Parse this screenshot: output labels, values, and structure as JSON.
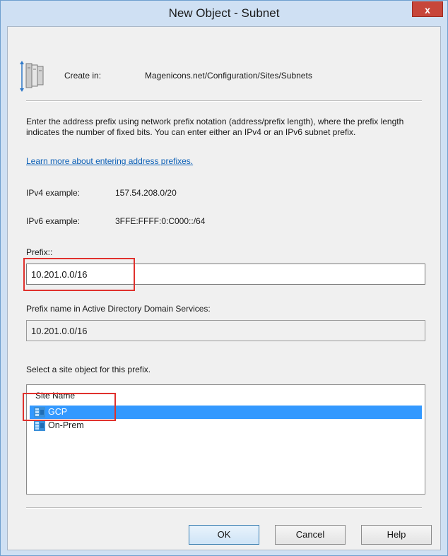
{
  "window": {
    "title": "New Object - Subnet",
    "close_glyph": "x"
  },
  "header": {
    "icon": "book-arrows-icon",
    "create_in_label": "Create in:",
    "create_in_path": "Magenicons.net/Configuration/Sites/Subnets"
  },
  "description": {
    "text": "Enter the address prefix using network prefix notation (address/prefix length), where the prefix length indicates the number of fixed bits. You can enter either an IPv4 or an IPv6 subnet prefix.",
    "link": "Learn more about entering address prefixes."
  },
  "examples": {
    "ipv4_label": "IPv4 example:",
    "ipv4_value": "157.54.208.0/20",
    "ipv6_label": "IPv6 example:",
    "ipv6_value": "3FFE:FFFF:0:C000::/64"
  },
  "prefix": {
    "label": "Prefix::",
    "value": "10.201.0.0/16"
  },
  "ad_name": {
    "label": "Prefix name in Active Directory Domain Services:",
    "value": "10.201.0.0/16"
  },
  "sites": {
    "label": "Select a site object for this prefix.",
    "column": "Site Name",
    "items": [
      {
        "name": "GCP",
        "selected": true
      },
      {
        "name": "On-Prem",
        "selected": false
      }
    ]
  },
  "buttons": {
    "ok": "OK",
    "cancel": "Cancel",
    "help": "Help"
  },
  "colors": {
    "selection": "#3399ff",
    "highlight": "#e0312d",
    "link": "#0b5fb6"
  }
}
